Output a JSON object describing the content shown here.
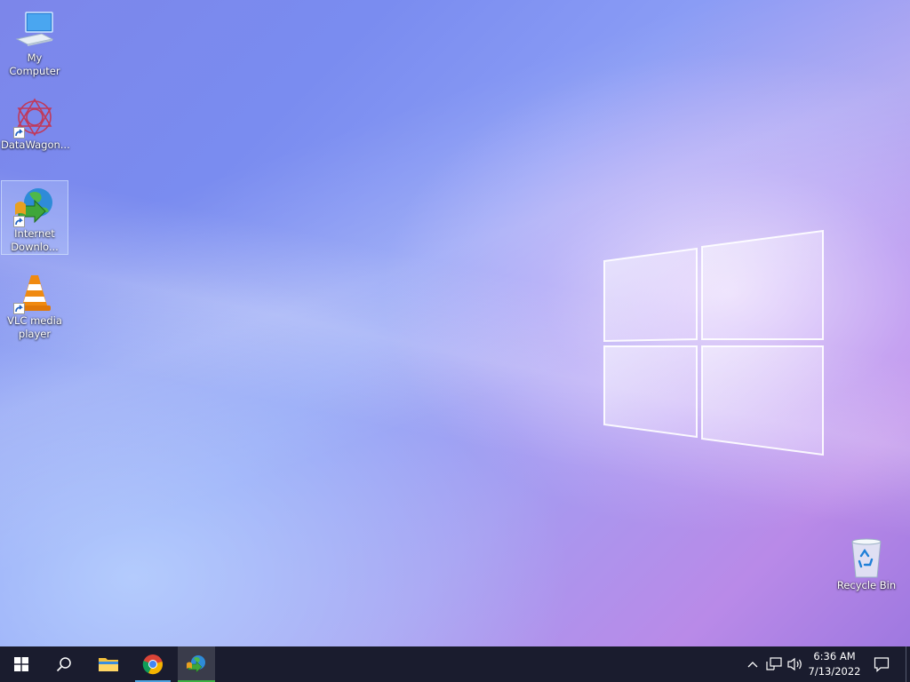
{
  "desktop": {
    "icons": [
      {
        "label": "My Computer",
        "icon": "computer-icon",
        "shortcut": false
      },
      {
        "label": "DataWagon...",
        "icon": "datawagon-icon",
        "shortcut": true
      },
      {
        "label": "Internet Downlo...",
        "icon": "internet-download-manager-icon",
        "shortcut": true,
        "selected": true
      },
      {
        "label": "VLC media player",
        "icon": "vlc-icon",
        "shortcut": true
      },
      {
        "label": "Recycle Bin",
        "icon": "recycle-bin-icon",
        "shortcut": false
      }
    ]
  },
  "taskbar": {
    "buttons": [
      {
        "name": "start",
        "icon": "windows-logo-icon"
      },
      {
        "name": "search",
        "icon": "search-icon"
      },
      {
        "name": "file-explorer",
        "icon": "folder-icon",
        "indicator_color": "#0078d4"
      },
      {
        "name": "chrome",
        "icon": "chrome-icon",
        "indicator_color": "#4fa3e0"
      },
      {
        "name": "internet-download-manager",
        "icon": "internet-download-manager-icon",
        "indicator_color": "#3cb043",
        "active": true
      }
    ],
    "tray": {
      "icons": [
        "chevron-up-icon",
        "network-icon",
        "volume-icon"
      ],
      "time": "6:36 AM",
      "date": "7/13/2022",
      "notification_icon": "notification-icon"
    }
  },
  "colors": {
    "taskbar_bg": "#1a1c2e",
    "accent": "#0078d4"
  }
}
